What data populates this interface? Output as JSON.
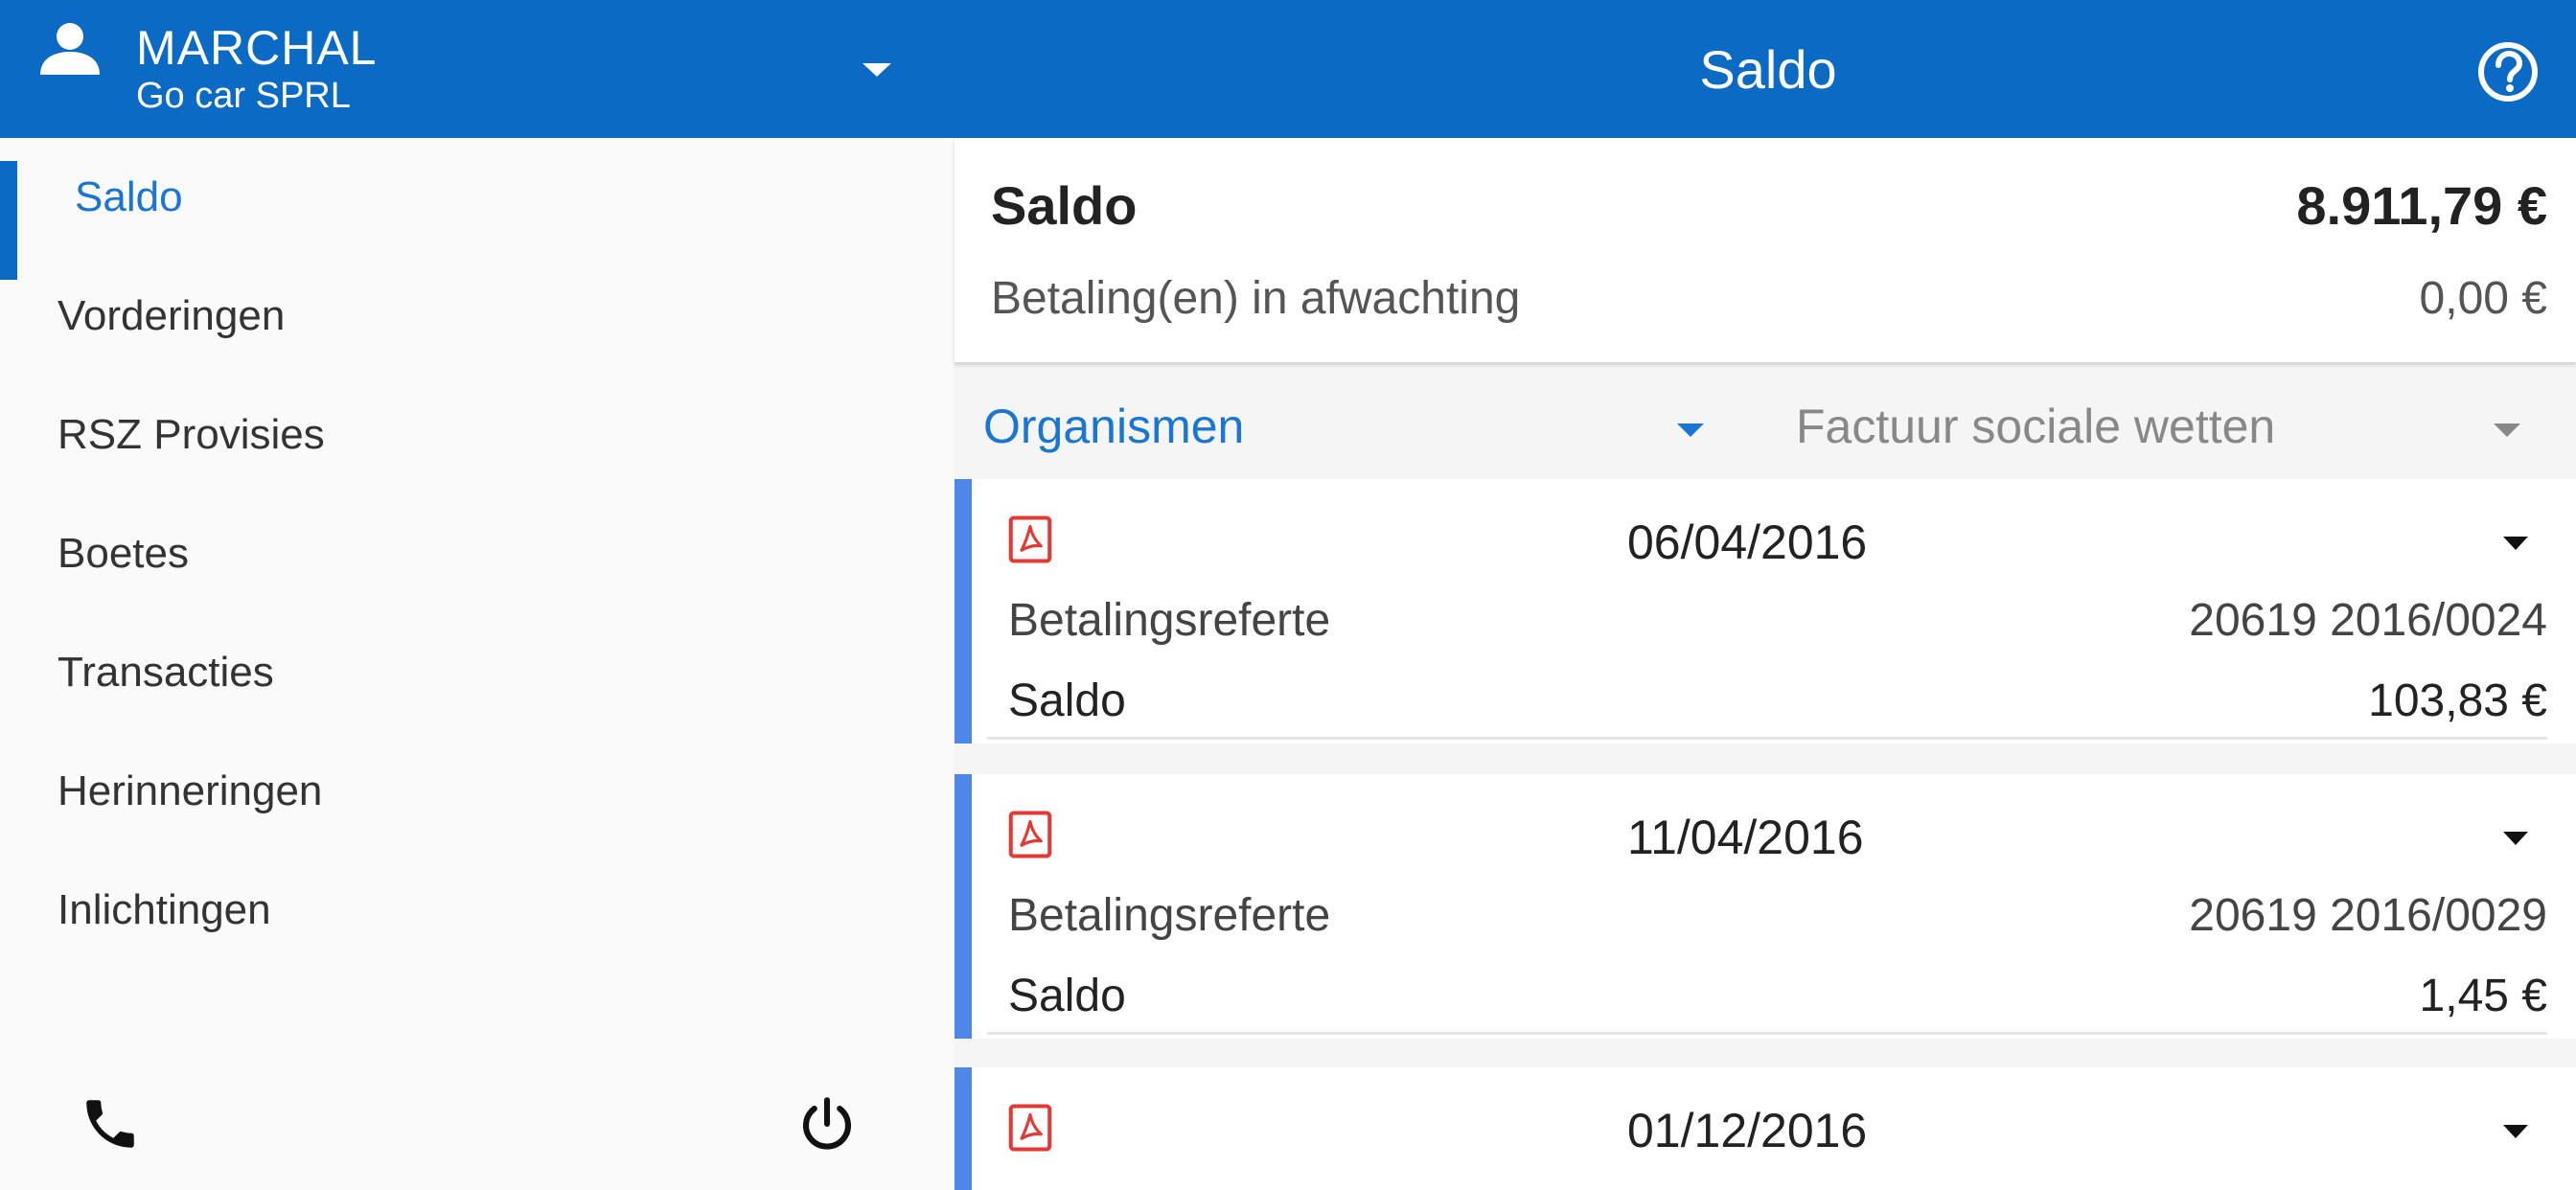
{
  "header": {
    "user_name": "MARCHAL",
    "company": "Go car SPRL",
    "title": "Saldo",
    "icons": {
      "user": "user-icon",
      "dropdown": "caret-down-icon",
      "help": "help-circle-icon"
    }
  },
  "sidebar": {
    "items": [
      {
        "label": "Saldo",
        "active": true
      },
      {
        "label": "Vorderingen",
        "active": false
      },
      {
        "label": "RSZ Provisies",
        "active": false
      },
      {
        "label": "Boetes",
        "active": false
      },
      {
        "label": "Transacties",
        "active": false
      },
      {
        "label": "Herinneringen",
        "active": false
      },
      {
        "label": "Inlichtingen",
        "active": false
      }
    ],
    "footer_icons": {
      "phone": "phone-icon",
      "logout": "power-icon"
    }
  },
  "summary": {
    "title": "Saldo",
    "amount": "8.911,79 €",
    "pending_label": "Betaling(en) in afwachting",
    "pending_amount": "0,00 €"
  },
  "filters": {
    "organism": "Organismen",
    "invoice_type": "Factuur sociale wetten"
  },
  "invoices": [
    {
      "date": "06/04/2016",
      "ref_label": "Betalingsreferte",
      "ref": "20619 2016/0024",
      "balance_label": "Saldo",
      "balance": "103,83 €",
      "icon": "pdf-icon"
    },
    {
      "date": "11/04/2016",
      "ref_label": "Betalingsreferte",
      "ref": "20619 2016/0029",
      "balance_label": "Saldo",
      "balance": "1,45 €",
      "icon": "pdf-icon"
    },
    {
      "date": "01/12/2016",
      "icon": "pdf-icon"
    }
  ],
  "colors": {
    "primary": "#0a6ac4",
    "accent_link": "#1976d2",
    "card_accent": "#4f87e8",
    "pdf_red": "#e53935"
  }
}
